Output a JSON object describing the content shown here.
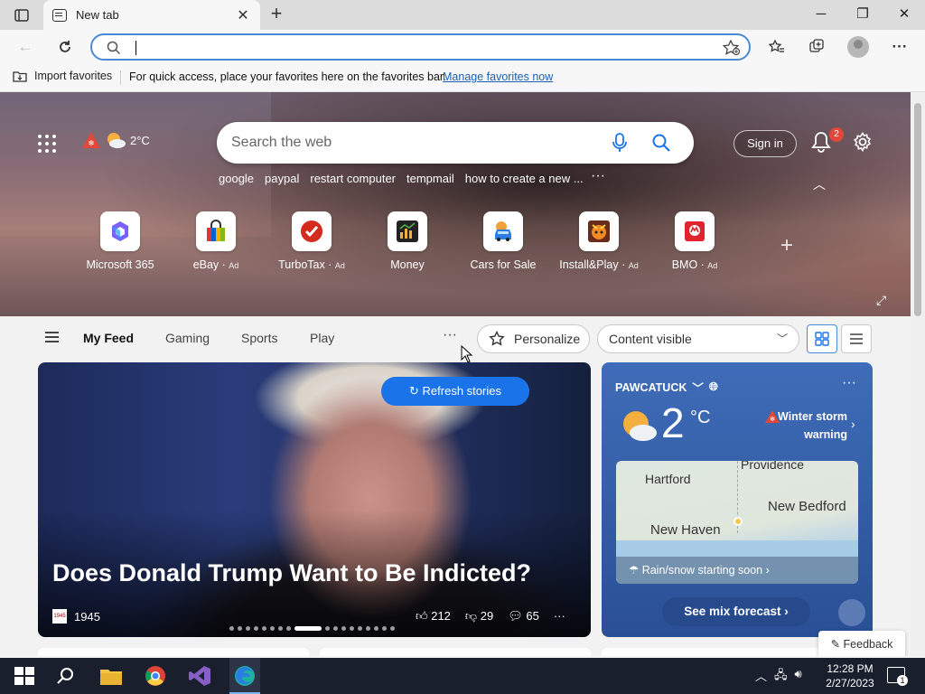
{
  "browser": {
    "tab_title": "New tab",
    "address_value": "",
    "favorites_bar": {
      "import_label": "Import favorites",
      "message": "For quick access, place your favorites here on the favorites bar.",
      "manage_link": "Manage favorites now"
    }
  },
  "hero": {
    "weather_temp": "2°C",
    "search_placeholder": "Search the web",
    "signin_label": "Sign in",
    "notification_count": "2",
    "trending": [
      "google",
      "paypal",
      "restart computer",
      "tempmail",
      "how to create a new ..."
    ],
    "tiles": [
      {
        "name": "Microsoft 365",
        "ad": ""
      },
      {
        "name": "eBay",
        "ad": "Ad"
      },
      {
        "name": "TurboTax",
        "ad": "Ad"
      },
      {
        "name": "Money",
        "ad": ""
      },
      {
        "name": "Cars for Sale",
        "ad": ""
      },
      {
        "name": "Install&Play",
        "ad": "Ad"
      },
      {
        "name": "BMO",
        "ad": "Ad"
      }
    ]
  },
  "feed_nav": {
    "tabs": [
      "My Feed",
      "Gaming",
      "Sports",
      "Play"
    ],
    "personalize_label": "Personalize",
    "content_select": "Content visible"
  },
  "story": {
    "refresh_label": "Refresh stories",
    "title": "Does Donald Trump Want to Be Indicted?",
    "source": "1945",
    "likes": "212",
    "dislikes": "29",
    "comments": "65",
    "slide_count": 18,
    "active_slide": 8
  },
  "weather_card": {
    "location": "PAWCATUCK",
    "temp": "2",
    "unit": "°C",
    "alert": "Winter storm warning",
    "map_cities": [
      "Hartford",
      "Providence",
      "New Bedford",
      "New Haven"
    ],
    "map_note": "Rain/snow starting soon",
    "forecast_label": "See mix forecast"
  },
  "feedback_label": "Feedback",
  "taskbar": {
    "time": "12:28 PM",
    "date": "2/27/2023",
    "notifications": "1"
  }
}
